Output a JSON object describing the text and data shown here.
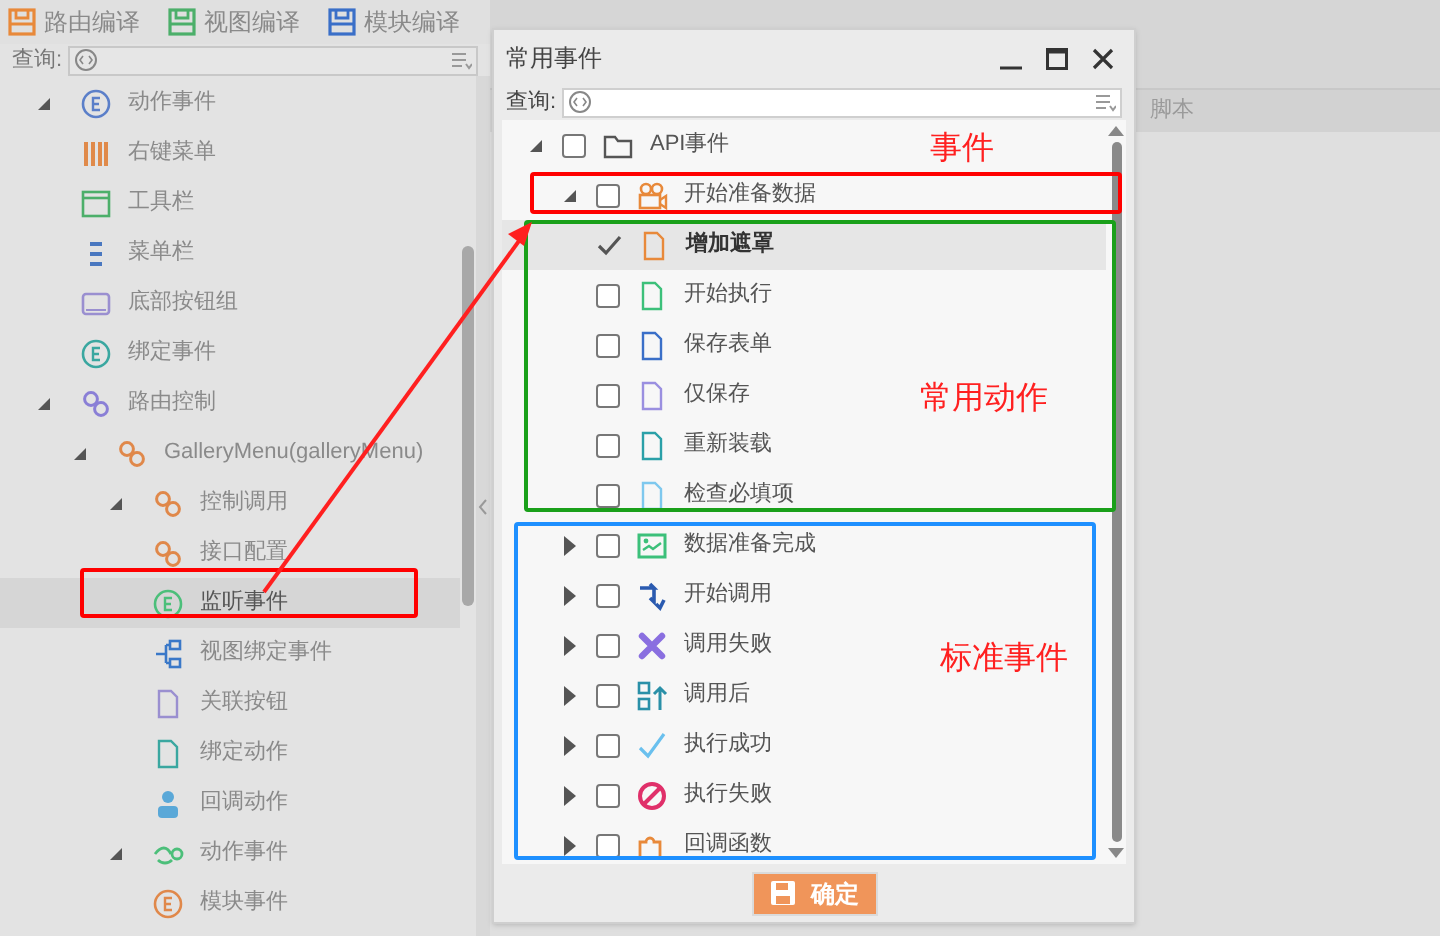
{
  "toolbar": [
    {
      "label": "路由编译"
    },
    {
      "label": "视图编译"
    },
    {
      "label": "模块编译"
    }
  ],
  "left_panel": {
    "search_label": "查询:",
    "tree": [
      {
        "label": "动作事件",
        "expanded": true,
        "selected": false,
        "children": [
          {
            "label": "右键菜单",
            "selected": false
          },
          {
            "label": "工具栏",
            "selected": false
          },
          {
            "label": "菜单栏",
            "selected": false
          },
          {
            "label": "底部按钮组",
            "selected": false
          },
          {
            "label": "绑定事件",
            "selected": false
          }
        ]
      },
      {
        "label": "路由控制",
        "expanded": true,
        "selected": false,
        "children": [
          {
            "label": "GalleryMenu(galleryMenu)",
            "expanded": true,
            "selected": false,
            "children": [
              {
                "label": "控制调用",
                "expanded": true,
                "selected": false,
                "children": [
                  {
                    "label": "接口配置",
                    "selected": false
                  },
                  {
                    "label": "监听事件",
                    "selected": true
                  },
                  {
                    "label": "视图绑定事件",
                    "selected": false
                  },
                  {
                    "label": "关联按钮",
                    "selected": false
                  },
                  {
                    "label": "绑定动作",
                    "selected": false
                  },
                  {
                    "label": "回调动作",
                    "selected": false
                  }
                ]
              },
              {
                "label": "动作事件",
                "expanded": true,
                "selected": false,
                "children": [
                  {
                    "label": "模块事件",
                    "selected": false
                  }
                ]
              }
            ]
          }
        ]
      }
    ]
  },
  "main": {
    "column_header": "脚本"
  },
  "dialog": {
    "title": "常用事件",
    "search_label": "查询:",
    "tree": [
      {
        "label": "API事件",
        "expanded": true,
        "checked": false,
        "selected": false,
        "children": [
          {
            "label": "开始准备数据",
            "expanded": true,
            "checked": false,
            "selected": false,
            "children": [
              {
                "label": "增加遮罩",
                "checked": true,
                "selected": true
              },
              {
                "label": "开始执行",
                "checked": false,
                "selected": false
              },
              {
                "label": "保存表单",
                "checked": false,
                "selected": false
              },
              {
                "label": "仅保存",
                "checked": false,
                "selected": false
              },
              {
                "label": "重新装载",
                "checked": false,
                "selected": false
              },
              {
                "label": "检查必填项",
                "checked": false,
                "selected": false
              }
            ]
          },
          {
            "label": "数据准备完成",
            "expanded": false,
            "checked": false,
            "selected": false
          },
          {
            "label": "开始调用",
            "expanded": false,
            "checked": false,
            "selected": false
          },
          {
            "label": "调用失败",
            "expanded": false,
            "checked": false,
            "selected": false
          },
          {
            "label": "调用后",
            "expanded": false,
            "checked": false,
            "selected": false
          },
          {
            "label": "执行成功",
            "expanded": false,
            "checked": false,
            "selected": false
          },
          {
            "label": "执行失败",
            "expanded": false,
            "checked": false,
            "selected": false
          },
          {
            "label": "回调函数",
            "expanded": false,
            "checked": false,
            "selected": false
          }
        ]
      }
    ],
    "confirm_button": "确定"
  },
  "annotations": {
    "boxes": [
      {
        "color": "#ff0000"
      },
      {
        "color": "#1aa01a"
      },
      {
        "color": "#1e90ff"
      },
      {
        "color": "#ff0000"
      }
    ],
    "labels": [
      "事件",
      "常用动作",
      "标准事件"
    ]
  }
}
